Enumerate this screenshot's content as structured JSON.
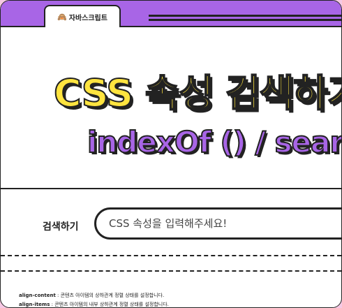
{
  "tab": {
    "icon": "🙈",
    "label": "자바스크립트"
  },
  "hero": {
    "title": "CSS 속성 검색하기",
    "subtitle": "indexOf () / search ()"
  },
  "search": {
    "label": "검색하기",
    "placeholder": "CSS 속성을 입력해주세요!"
  },
  "properties": [
    {
      "name": "align-content",
      "desc": " : 콘텐츠 아이템의 상하관계 정렬 상태를 설정합니다."
    },
    {
      "name": "align-items",
      "desc": " : 콘텐츠 아이템의 내부 상하관계 정렬 상태를 설정합니다."
    }
  ]
}
